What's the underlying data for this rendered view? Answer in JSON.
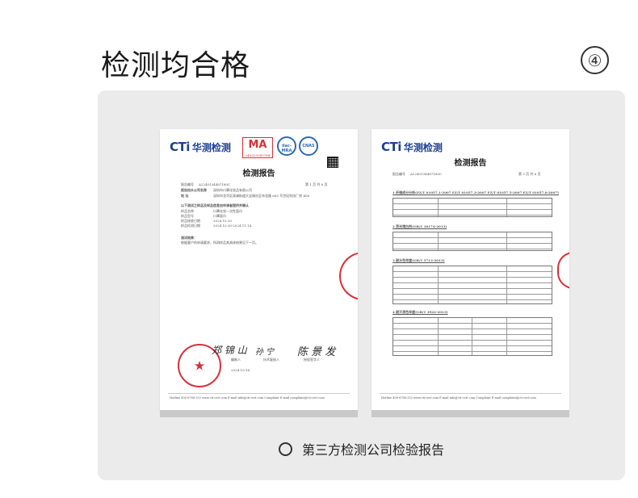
{
  "header": {
    "title": "检测均合格",
    "step": "④"
  },
  "left_doc": {
    "logo_text": "CTi",
    "logo_cn": "华测检测",
    "ma_label": "MA",
    "ma_number": "240020349784",
    "ilac_label": "ilac-MRA",
    "cnas_label": "CNAS",
    "report_title": "检测报告",
    "report_no_label": "报告编号",
    "report_no": "A2240134487180C",
    "page_info": "第 1 页  共 8 页",
    "applicant_label": "报告抬头公司名称",
    "applicant": "深圳市口罩化妆品有限公司",
    "address_label": "地    址",
    "address": "深圳市龙华区观澜街道大宝城社区布龙路 665 号世纪科技厂房 408",
    "sample_heading": "以下测试之样品及样品信息由申请者提供并确认",
    "sample_name_label": "样品名称",
    "sample_name": "口罩化妆一次性面巾",
    "sample_model_label": "样品型号",
    "sample_model": "口罩面巾",
    "receive_date_label": "样品接收日期",
    "receive_date": "2024.10.30",
    "test_date_label": "样品检测日期",
    "test_date": "2024.10.30-2024.11.14",
    "result_heading": "测试结果：",
    "result_text": "根据客户的申请要求，所测样品其具体结果见下一页。",
    "sig1": "郑 锦 山",
    "sig2": "孙 宁",
    "sig3": "陈 景 发",
    "role1": "编制人",
    "role2": "技术复核人",
    "role3": "授权签字人",
    "date": "2024-10-14",
    "footer": "Hotline 400-6788-333   www.cti-cert.com   E-mail info@cti-cert.com   Complaint E-mail complaint@cti-cert.com"
  },
  "right_doc": {
    "logo_text": "CTi",
    "logo_cn": "华测检测",
    "report_title": "检测报告",
    "report_no_label": "报告编号",
    "report_no": "A2240134487180C",
    "page_info": "第 3 页  共 8 页",
    "sections": [
      "1  纤维成分分析(FZ/T 01057.1-2007 FZ/T 01057.3-2007 FZ/T 01057.5-2007 FZ/T 01057.6-2007)",
      "2  荧光增白剂(GB/T 30174-2013)",
      "3  耐水色牢度(GB/T 5713-2013)",
      "4  耐汗渍色牢度(GB/T 3922-2013)"
    ],
    "footer": "Hotline 400-6788-333   www.cti-cert.com   E-mail info@cti-cert.com   Complaint E-mail complaint@cti-cert.com"
  },
  "caption": "第三方检测公司检验报告",
  "colors": {
    "panel_bg": "#ebebeb",
    "brand_blue": "#1d3f93",
    "seal_red": "#d8303a"
  }
}
